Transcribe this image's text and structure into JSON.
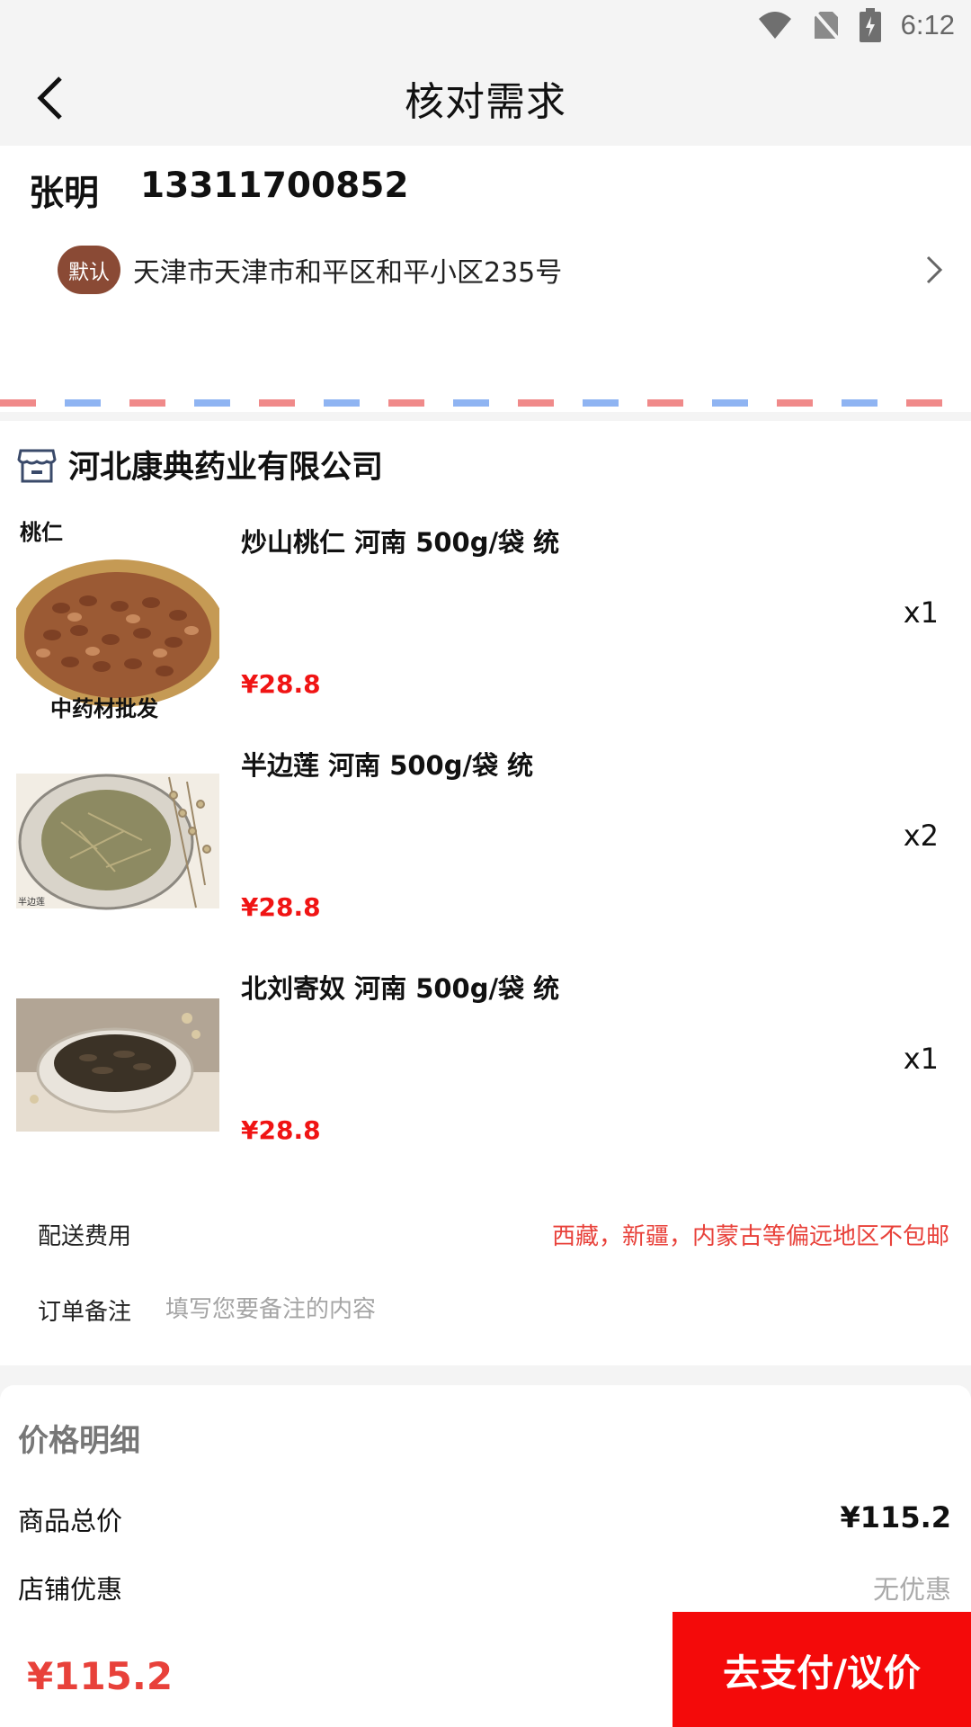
{
  "status": {
    "time": "6:12"
  },
  "header": {
    "title": "核对需求"
  },
  "address": {
    "name": "张明",
    "phone": "13311700852",
    "badge": "默认",
    "text": "天津市天津市和平区和平小区235号"
  },
  "shop": {
    "name": "河北康典药业有限公司",
    "products": [
      {
        "name": "炒山桃仁 河南 500g/袋 统",
        "price": "¥28.8",
        "qty": "x1",
        "img_top_text": "桃仁",
        "img_bottom_text": "中药材批发"
      },
      {
        "name": "半边莲 河南 500g/袋 统",
        "price": "¥28.8",
        "qty": "x2",
        "img_corner_text": "半边莲"
      },
      {
        "name": "北刘寄奴 河南 500g/袋 统",
        "price": "¥28.8",
        "qty": "x1"
      }
    ],
    "delivery_label": "配送费用",
    "delivery_note": "西藏，新疆，内蒙古等偏远地区不包邮",
    "remark_label": "订单备注",
    "remark_placeholder": "填写您要备注的内容"
  },
  "price_detail": {
    "title": "价格明细",
    "goods_total_label": "商品总价",
    "goods_total_value": "¥115.2",
    "shop_discount_label": "店铺优惠",
    "shop_discount_value": "无优惠"
  },
  "bottom": {
    "total": "¥115.2",
    "pay_label": "去支付/议价"
  },
  "colors": {
    "accent_red": "#f40a0a",
    "price_red": "#f01414",
    "badge_brown": "#8a4a35"
  }
}
